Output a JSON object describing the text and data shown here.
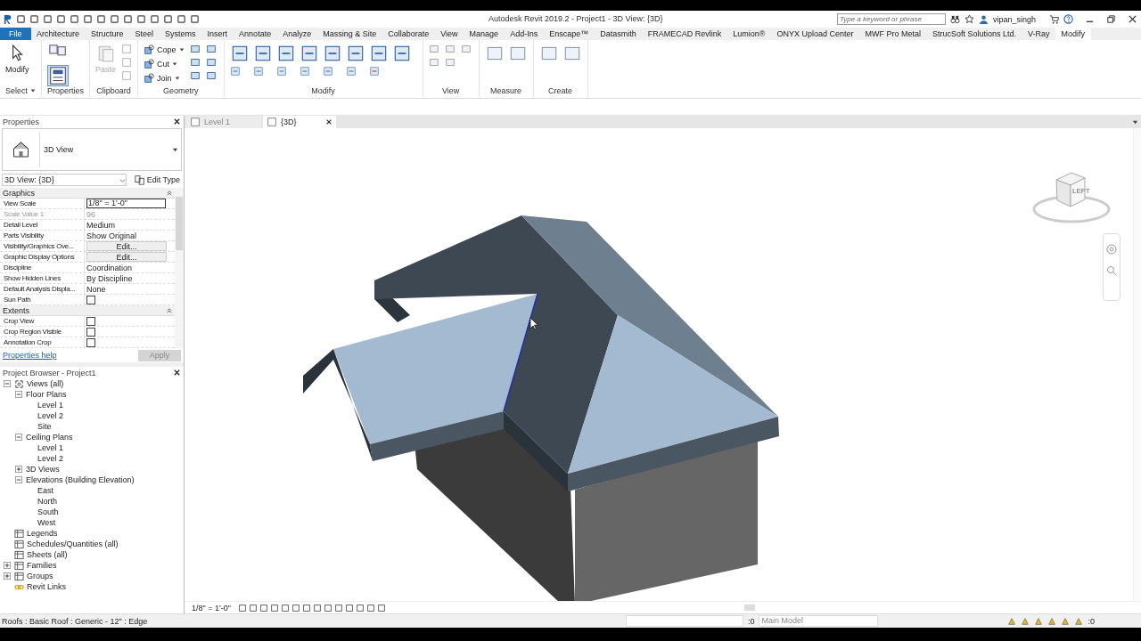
{
  "title_bar": {
    "title": "Autodesk Revit 2019.2 - Project1 - 3D View: {3D}",
    "search": {
      "placeholder": "Type a keyword or phrase"
    },
    "user": "vipan_singh"
  },
  "menu_tabs": [
    {
      "label": "File",
      "kind": "file",
      "selected": false
    },
    {
      "label": "Architecture",
      "kind": "tab",
      "selected": false
    },
    {
      "label": "Structure",
      "kind": "tab",
      "selected": false
    },
    {
      "label": "Steel",
      "kind": "tab",
      "selected": false
    },
    {
      "label": "Systems",
      "kind": "tab",
      "selected": false
    },
    {
      "label": "Insert",
      "kind": "tab",
      "selected": false
    },
    {
      "label": "Annotate",
      "kind": "tab",
      "selected": false
    },
    {
      "label": "Analyze",
      "kind": "tab",
      "selected": false
    },
    {
      "label": "Massing & Site",
      "kind": "tab",
      "selected": false
    },
    {
      "label": "Collaborate",
      "kind": "tab",
      "selected": false
    },
    {
      "label": "View",
      "kind": "tab",
      "selected": false
    },
    {
      "label": "Manage",
      "kind": "tab",
      "selected": false
    },
    {
      "label": "Add-Ins",
      "kind": "tab",
      "selected": false
    },
    {
      "label": "Enscape™",
      "kind": "tab",
      "selected": false
    },
    {
      "label": "Datasmith",
      "kind": "tab",
      "selected": false
    },
    {
      "label": "FRAMECAD Revlink",
      "kind": "tab",
      "selected": false
    },
    {
      "label": "Lumion®",
      "kind": "tab",
      "selected": false
    },
    {
      "label": "ONYX Upload Center",
      "kind": "tab",
      "selected": false
    },
    {
      "label": "MWF Pro Metal",
      "kind": "tab",
      "selected": false
    },
    {
      "label": "StrucSoft Solutions Ltd.",
      "kind": "tab",
      "selected": false
    },
    {
      "label": "V-Ray",
      "kind": "tab",
      "selected": false
    },
    {
      "label": "Modify",
      "kind": "tab",
      "selected": true
    }
  ],
  "ribbon": [
    {
      "label": "Select",
      "dropdown": true,
      "buttons": [
        {
          "label": "Modify",
          "disabled": false
        }
      ]
    },
    {
      "label": "Properties"
    },
    {
      "label": "Clipboard",
      "buttons": [
        {
          "label": "Paste",
          "disabled": true
        }
      ]
    },
    {
      "label": "Geometry",
      "buttons": [
        {
          "label": "Cope",
          "disabled": false
        },
        {
          "label": "Cut",
          "disabled": false
        },
        {
          "label": "Join",
          "disabled": false
        }
      ]
    },
    {
      "label": "Modify"
    },
    {
      "label": "View"
    },
    {
      "label": "Measure"
    },
    {
      "label": "Create"
    }
  ],
  "properties": {
    "header": "Properties",
    "type_name": "3D View",
    "type_selector": "3D View: {3D}",
    "edit_type": "Edit Type",
    "groups": [
      {
        "name": "Graphics",
        "rows": [
          {
            "label": "View Scale",
            "kind": "field",
            "value": "1/8\" = 1'-0\"",
            "disabled": false
          },
          {
            "label": "Scale Value    1:",
            "kind": "text",
            "value": "96",
            "disabled": true
          },
          {
            "label": "Detail Level",
            "kind": "text",
            "value": "Medium",
            "disabled": false
          },
          {
            "label": "Parts Visibility",
            "kind": "text",
            "value": "Show Original",
            "disabled": false
          },
          {
            "label": "Visibility/Graphics Ove...",
            "kind": "button",
            "value": "Edit...",
            "disabled": false
          },
          {
            "label": "Graphic Display Options",
            "kind": "button",
            "value": "Edit...",
            "disabled": false
          },
          {
            "label": "Discipline",
            "kind": "text",
            "value": "Coordination",
            "disabled": false
          },
          {
            "label": "Show Hidden Lines",
            "kind": "text",
            "value": "By Discipline",
            "disabled": false
          },
          {
            "label": "Default Analysis Displa...",
            "kind": "text",
            "value": "None",
            "disabled": false
          },
          {
            "label": "Sun Path",
            "kind": "checkbox",
            "checked": false,
            "disabled": false
          }
        ]
      },
      {
        "name": "Extents",
        "rows": [
          {
            "label": "Crop View",
            "kind": "checkbox",
            "checked": false,
            "disabled": false
          },
          {
            "label": "Crop Region Visible",
            "kind": "checkbox",
            "checked": false,
            "disabled": false
          },
          {
            "label": "Annotation Crop",
            "kind": "checkbox",
            "checked": false,
            "disabled": false
          }
        ]
      }
    ],
    "help_link": "Properties help",
    "apply": {
      "label": "Apply",
      "disabled": true
    }
  },
  "project_browser": {
    "header": "Project Browser - Project1",
    "tree": [
      {
        "label": "Views (all)",
        "expanded": true,
        "children": [
          {
            "label": "Floor Plans",
            "expanded": true,
            "children": [
              {
                "label": "Level 1"
              },
              {
                "label": "Level 2"
              },
              {
                "label": "Site"
              }
            ]
          },
          {
            "label": "Ceiling Plans",
            "expanded": true,
            "children": [
              {
                "label": "Level 1"
              },
              {
                "label": "Level 2"
              }
            ]
          },
          {
            "label": "3D Views",
            "expanded": false
          },
          {
            "label": "Elevations (Building Elevation)",
            "expanded": true,
            "children": [
              {
                "label": "East"
              },
              {
                "label": "North"
              },
              {
                "label": "South"
              },
              {
                "label": "West"
              }
            ]
          }
        ]
      },
      {
        "label": "Legends"
      },
      {
        "label": "Schedules/Quantities (all)"
      },
      {
        "label": "Sheets (all)"
      },
      {
        "label": "Families",
        "expanded": false
      },
      {
        "label": "Groups",
        "expanded": false
      },
      {
        "label": "Revit Links"
      }
    ]
  },
  "view_tabs": [
    {
      "label": "Level 1",
      "selected": false
    },
    {
      "label": "{3D}",
      "selected": true
    }
  ],
  "view_cube": {
    "face": "LEFT"
  },
  "view_bar": {
    "scale": "1/8\" = 1'-0\""
  },
  "status_bar": {
    "selection": "Roofs : Basic Roof : Generic - 12\" : Edge",
    "count": ":0",
    "workset": "Main Model",
    "filter_count": ":0"
  }
}
